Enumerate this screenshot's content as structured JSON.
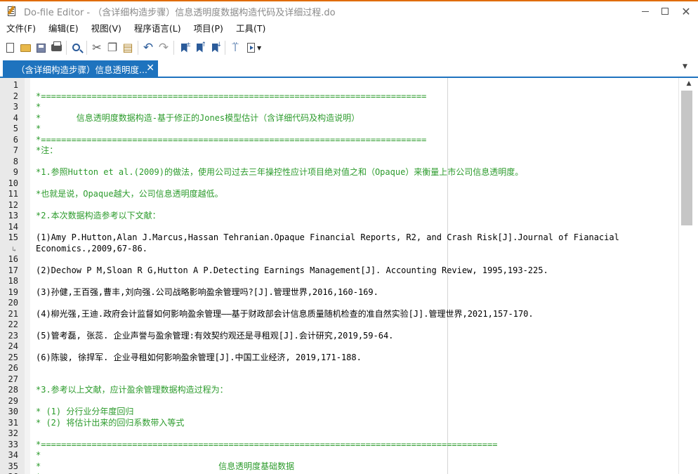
{
  "window": {
    "title": "Do-file Editor - （含详细构造步骤）信息透明度数据构造代码及详细过程.do"
  },
  "menu": [
    {
      "label": "文件(F)"
    },
    {
      "label": "编辑(E)"
    },
    {
      "label": "视图(V)"
    },
    {
      "label": "程序语言(L)"
    },
    {
      "label": "项目(P)"
    },
    {
      "label": "工具(T)"
    }
  ],
  "toolbar": {
    "icons": [
      "new-file-icon",
      "open-folder-icon",
      "save-icon",
      "print-icon",
      "find-icon",
      "cut-icon",
      "copy-icon",
      "paste-icon",
      "undo-icon",
      "redo-icon",
      "toggle-bookmark-icon",
      "previous-bookmark-icon",
      "next-bookmark-icon",
      "show-preview-icon",
      "execute-icon"
    ]
  },
  "tab": {
    "label": "（含详细构造步骤）信息透明度...",
    "close_glyph": "✕"
  },
  "colors": {
    "comment": "#2c9b2c",
    "tab_active": "#1e73be",
    "gutter": "#e9e9e9"
  },
  "editor": {
    "lines": [
      {
        "n": "1",
        "text": "",
        "kind": "plain"
      },
      {
        "n": "2",
        "text": "*============================================================================",
        "kind": "comment"
      },
      {
        "n": "3",
        "text": "*",
        "kind": "comment"
      },
      {
        "n": "4",
        "text": "*       信息透明度数据构造-基于修正的Jones模型估计（含详细代码及构造说明）",
        "kind": "comment"
      },
      {
        "n": "5",
        "text": "*",
        "kind": "comment"
      },
      {
        "n": "6",
        "text": "*============================================================================",
        "kind": "comment"
      },
      {
        "n": "7",
        "text": "*注：",
        "kind": "comment"
      },
      {
        "n": "8",
        "text": "",
        "kind": "plain"
      },
      {
        "n": "9",
        "text": "*1.参照Hutton et al.(2009)的做法，使用公司过去三年操控性应计项目绝对值之和（Opaque）来衡量上市公司信息透明度。",
        "kind": "comment"
      },
      {
        "n": "10",
        "text": "",
        "kind": "plain"
      },
      {
        "n": "11",
        "text": "*也就是说，Opaque越大，公司信息透明度越低。",
        "kind": "comment"
      },
      {
        "n": "12",
        "text": "",
        "kind": "plain"
      },
      {
        "n": "13",
        "text": "*2.本次数据构造参考以下文献：",
        "kind": "comment"
      },
      {
        "n": "14",
        "text": "",
        "kind": "plain"
      },
      {
        "n": "15",
        "text": "(1)Amy P.Hutton,Alan J.Marcus,Hassan Tehranian.Opaque Financial Reports, R2, and Crash Risk[J].Journal of Fianacial",
        "kind": "plain"
      },
      {
        "n": "",
        "text": "Economics.,2009,67-86.",
        "kind": "plain",
        "wrap": true
      },
      {
        "n": "16",
        "text": "",
        "kind": "plain"
      },
      {
        "n": "17",
        "text": "(2)Dechow P M,Sloan R G,Hutton A P.Detecting Earnings Management[J]. Accounting Review, 1995,193-225.",
        "kind": "plain"
      },
      {
        "n": "18",
        "text": "",
        "kind": "plain"
      },
      {
        "n": "19",
        "text": "(3)孙健,王百强,曹丰,刘向强.公司战略影响盈余管理吗?[J].管理世界,2016,160-169.",
        "kind": "plain"
      },
      {
        "n": "20",
        "text": "",
        "kind": "plain"
      },
      {
        "n": "21",
        "text": "(4)柳光强,王迪.政府会计监督如何影响盈余管理——基于财政部会计信息质量随机检查的准自然实验[J].管理世界,2021,157-170.",
        "kind": "plain"
      },
      {
        "n": "22",
        "text": "",
        "kind": "plain"
      },
      {
        "n": "23",
        "text": "(5)管考磊, 张蕊. 企业声誉与盈余管理:有效契约观还是寻租观[J].会计研究,2019,59-64.",
        "kind": "plain"
      },
      {
        "n": "24",
        "text": "",
        "kind": "plain"
      },
      {
        "n": "25",
        "text": "(6)陈骏, 徐捍军. 企业寻租如何影响盈余管理[J].中国工业经济, 2019,171-188.",
        "kind": "plain"
      },
      {
        "n": "26",
        "text": "",
        "kind": "plain"
      },
      {
        "n": "27",
        "text": "",
        "kind": "plain"
      },
      {
        "n": "28",
        "text": "*3.参考以上文献，应计盈余管理数据构造过程为：",
        "kind": "comment"
      },
      {
        "n": "29",
        "text": "",
        "kind": "plain"
      },
      {
        "n": "30",
        "text": "* (1) 分行业分年度回归",
        "kind": "comment"
      },
      {
        "n": "31",
        "text": "* (2) 将估计出来的回归系数带入等式",
        "kind": "comment"
      },
      {
        "n": "32",
        "text": "",
        "kind": "plain"
      },
      {
        "n": "33",
        "text": "*==========================================================================================",
        "kind": "comment"
      },
      {
        "n": "34",
        "text": "*",
        "kind": "comment"
      },
      {
        "n": "35",
        "text": "*                                   信息透明度基础数据",
        "kind": "comment"
      },
      {
        "n": "36",
        "text": "*",
        "kind": "comment"
      }
    ]
  }
}
